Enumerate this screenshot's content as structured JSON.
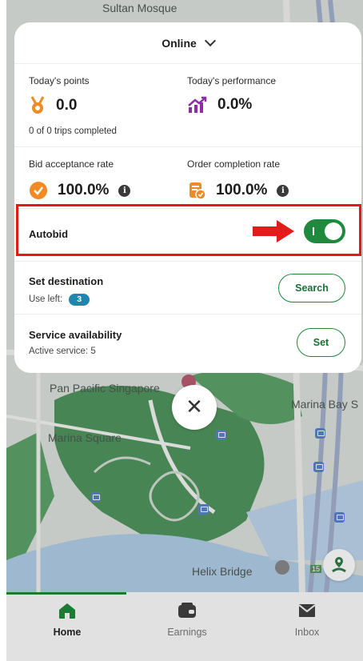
{
  "header": {
    "status_label": "Online"
  },
  "stats": {
    "points_label": "Today's points",
    "points_value": "0.0",
    "trips_completed": "0 of 0 trips completed",
    "performance_label": "Today's performance",
    "performance_value": "0.0%",
    "bid_acceptance_label": "Bid acceptance rate",
    "bid_acceptance_value": "100.0%",
    "order_completion_label": "Order completion rate",
    "order_completion_value": "100.0%",
    "info_glyph": "i"
  },
  "autobid": {
    "label": "Autobid",
    "enabled": true
  },
  "destination": {
    "title": "Set destination",
    "use_left_label": "Use left:",
    "use_left_count": "3",
    "button_label": "Search"
  },
  "service": {
    "title": "Service availability",
    "active_label": "Active service: 5",
    "button_label": "Set"
  },
  "close_glyph": "✕",
  "map": {
    "labels": {
      "top": "Sultan Mosque",
      "pan_pacific": "Pan Pacific Singapore",
      "marina_bay": "Marina Bay S",
      "marina_square": "Marina Square",
      "helix": "Helix Bridge",
      "road_number": "15"
    }
  },
  "nav": {
    "items": [
      {
        "label": "Home",
        "icon": "home-icon",
        "active": true
      },
      {
        "label": "Earnings",
        "icon": "wallet-icon",
        "active": false
      },
      {
        "label": "Inbox",
        "icon": "inbox-icon",
        "active": false
      }
    ]
  },
  "colors": {
    "accent_green": "#1f8a3e",
    "highlight_red": "#e21b1b",
    "badge_blue": "#1f86b0",
    "points_orange": "#f08a24",
    "performance_purple": "#8b2fa6"
  }
}
